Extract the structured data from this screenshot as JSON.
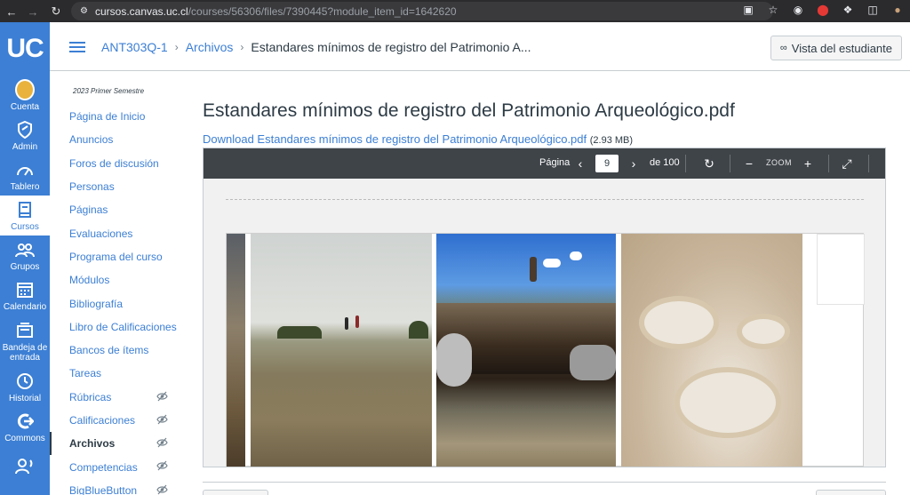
{
  "browser": {
    "url_host": "cursos.canvas.uc.cl",
    "url_path": "/courses/56306/files/7390445?module_item_id=1642620"
  },
  "global_nav": {
    "logo": "UC",
    "items": [
      {
        "label": "Cuenta",
        "icon": "avatar"
      },
      {
        "label": "Admin",
        "icon": "shield-icon"
      },
      {
        "label": "Tablero",
        "icon": "dashboard-icon"
      },
      {
        "label": "Cursos",
        "icon": "book-icon"
      },
      {
        "label": "Grupos",
        "icon": "groups-icon"
      },
      {
        "label": "Calendario",
        "icon": "calendar-icon"
      },
      {
        "label": "Bandeja de entrada",
        "icon": "inbox-icon"
      },
      {
        "label": "Historial",
        "icon": "clock-icon"
      },
      {
        "label": "Commons",
        "icon": "commons-icon"
      }
    ]
  },
  "header": {
    "breadcrumb": [
      "ANT303Q-1",
      "Archivos",
      "Estandares mínimos de registro del Patrimonio A..."
    ],
    "student_view": "Vista del estudiante"
  },
  "course_nav": {
    "term": "2023 Primer Semestre",
    "items": [
      {
        "label": "Página de Inicio",
        "hidden": false
      },
      {
        "label": "Anuncios",
        "hidden": false
      },
      {
        "label": "Foros de discusión",
        "hidden": false
      },
      {
        "label": "Personas",
        "hidden": false
      },
      {
        "label": "Páginas",
        "hidden": false
      },
      {
        "label": "Evaluaciones",
        "hidden": false
      },
      {
        "label": "Programa del curso",
        "hidden": false
      },
      {
        "label": "Módulos",
        "hidden": false
      },
      {
        "label": "Bibliografía",
        "hidden": false
      },
      {
        "label": "Libro de Calificaciones",
        "hidden": false
      },
      {
        "label": "Bancos de ítems",
        "hidden": false
      },
      {
        "label": "Tareas",
        "hidden": false
      },
      {
        "label": "Rúbricas",
        "hidden": true
      },
      {
        "label": "Calificaciones",
        "hidden": true
      },
      {
        "label": "Archivos",
        "hidden": true,
        "active": true
      },
      {
        "label": "Competencias",
        "hidden": true
      },
      {
        "label": "BigBlueButton",
        "hidden": true
      }
    ]
  },
  "content": {
    "title": "Estandares mínimos de registro del Patrimonio Arqueológico.pdf",
    "download_label": "Download Estandares mínimos de registro del Patrimonio Arqueológico.pdf",
    "file_size": "(2.93 MB)"
  },
  "viewer": {
    "page_label": "Página",
    "page_value": "9",
    "of_label": "de 100",
    "zoom_label": "ZOOM"
  }
}
